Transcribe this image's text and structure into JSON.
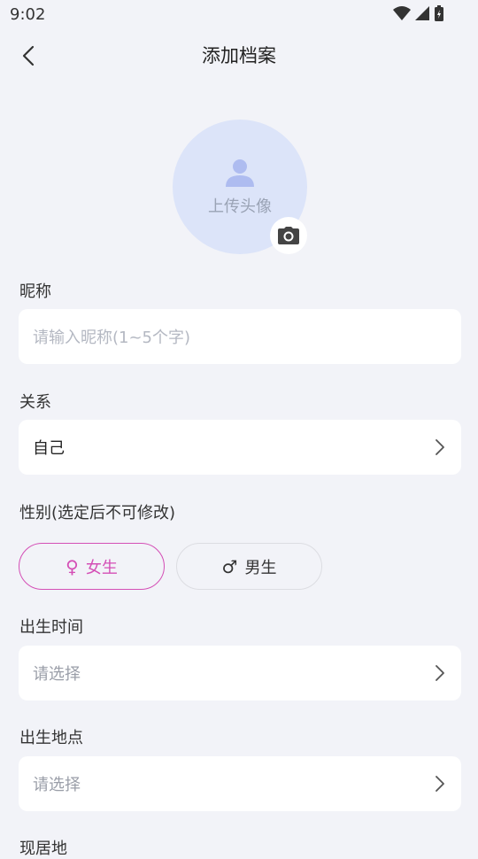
{
  "status": {
    "time": "9:02"
  },
  "nav": {
    "title": "添加档案"
  },
  "avatar": {
    "label": "上传头像"
  },
  "nickname": {
    "label": "昵称",
    "placeholder": "请输入昵称(1~5个字)"
  },
  "relation": {
    "label": "关系",
    "value": "自己"
  },
  "gender": {
    "label": "性别(选定后不可修改)",
    "options": [
      {
        "symbol": "♀",
        "label": "女生",
        "selected": true
      },
      {
        "symbol": "♂",
        "label": "男生",
        "selected": false
      }
    ]
  },
  "birth_time": {
    "label": "出生时间",
    "placeholder": "请选择"
  },
  "birth_place": {
    "label": "出生地点",
    "placeholder": "请选择"
  },
  "residence": {
    "label": "现居地"
  },
  "colors": {
    "accent": "#d44fb6",
    "avatar_bg": "#dce4f9",
    "page_bg": "#f2f3f8"
  }
}
